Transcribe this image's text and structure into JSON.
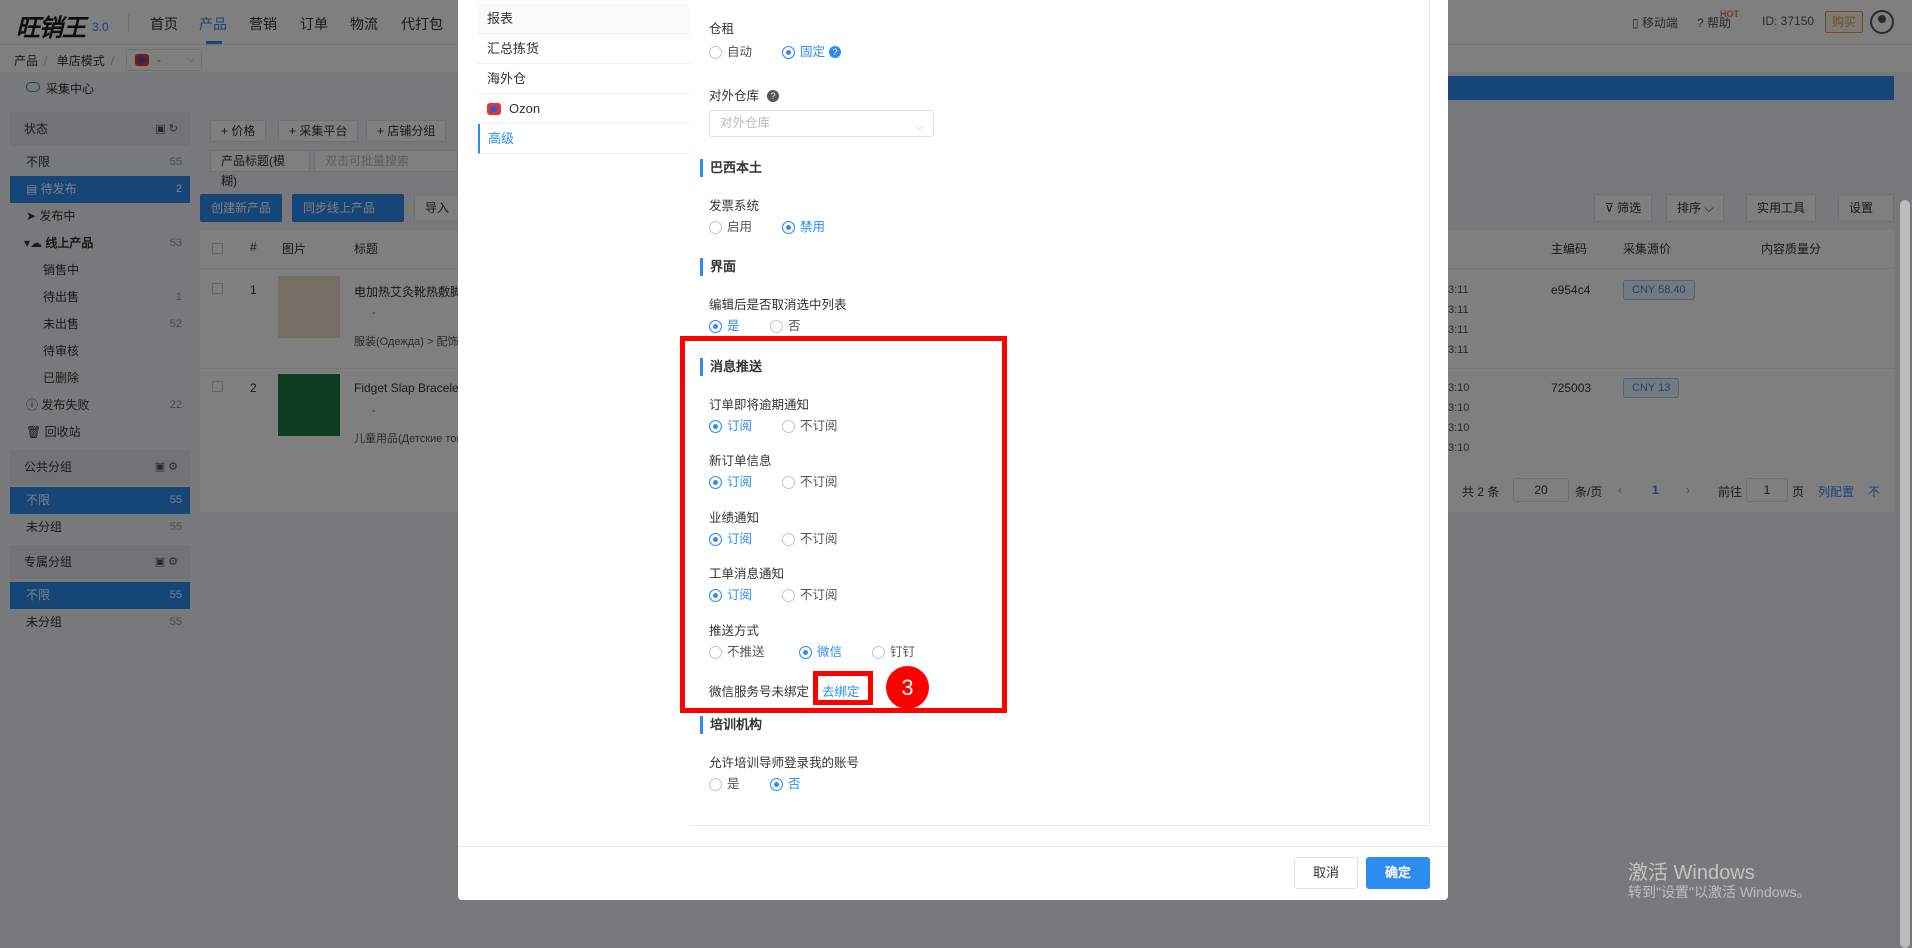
{
  "topnav": {
    "logo": "旺销王",
    "version": "3.0",
    "items": [
      "首页",
      "产品",
      "营销",
      "订单",
      "物流",
      "代打包"
    ],
    "mobile": "移动端",
    "hot": "HOT",
    "help": "帮助",
    "account_id": "ID: 37150",
    "buy": "购买"
  },
  "breadcrumb": {
    "items": [
      "产品",
      "单店模式"
    ],
    "store": "-"
  },
  "sidebar": {
    "collect": "采集中心",
    "status_header": "状态",
    "status": [
      {
        "label": "不限",
        "count": "55"
      },
      {
        "label": "待发布",
        "count": "2"
      },
      {
        "label": "发布中",
        "count": ""
      },
      {
        "label": "线上产品",
        "count": "53"
      },
      {
        "label": "销售中",
        "count": ""
      },
      {
        "label": "待出售",
        "count": "1"
      },
      {
        "label": "未出售",
        "count": "52"
      },
      {
        "label": "待审核",
        "count": ""
      },
      {
        "label": "已删除",
        "count": ""
      },
      {
        "label": "发布失败",
        "count": "22"
      },
      {
        "label": "回收站",
        "count": ""
      }
    ],
    "public_header": "公共分组",
    "public": [
      {
        "label": "不限",
        "count": "55"
      },
      {
        "label": "未分组",
        "count": "55"
      }
    ],
    "private_header": "专属分组",
    "private": [
      {
        "label": "不限",
        "count": "55"
      },
      {
        "label": "未分组",
        "count": "55"
      }
    ]
  },
  "toolbar": {
    "price": "+ 价格",
    "platform": "+ 采集平台",
    "store_group": "+ 店铺分组",
    "search_type": "产品标题(模糊)",
    "search_placeholder": "双击可批量搜索",
    "create": "创建新产品",
    "sync": "同步线上产品",
    "import": "导入",
    "filter": "筛选",
    "sort": "排序",
    "tools": "实用工具",
    "settings": "设置"
  },
  "table": {
    "headers": [
      "#",
      "图片",
      "标题",
      "主编码",
      "采集源价",
      "内容质量分"
    ],
    "rows": [
      {
        "idx": "1",
        "title": "电加热艾灸靴热敷脚",
        "category": "服装(Одежда) > 配饰",
        "code": "e954c4",
        "price": "CNY 58.40",
        "times": [
          "3:11",
          "3:11",
          "3:11",
          "3:11"
        ],
        "ozon": "-"
      },
      {
        "idx": "2",
        "title": "Fidget Slap Bracelet",
        "category": "儿童用品(Детские тов",
        "code": "725003",
        "price": "CNY 13",
        "times": [
          "3:10",
          "3:10",
          "3:10",
          "3:10"
        ],
        "ozon": "-"
      }
    ]
  },
  "pager": {
    "total": "共 2 条",
    "size": "20",
    "per_page": "条/页",
    "current": "1",
    "goto": "前往",
    "goto_val": "1",
    "page": "页",
    "config": "列配置",
    "top": "不"
  },
  "modal": {
    "nav": [
      "报表",
      "汇总拣货",
      "海外仓",
      "Ozon",
      "高级"
    ],
    "rent_label": "仓租",
    "rent_auto": "自动",
    "rent_fixed": "固定",
    "ext_wh_label": "对外仓库",
    "ext_wh_placeholder": "对外仓库",
    "brazil_section": "巴西本土",
    "invoice_label": "发票系统",
    "invoice_on": "启用",
    "invoice_off": "禁用",
    "ui_section": "界面",
    "deselect_label": "编辑后是否取消选中列表",
    "yes": "是",
    "no": "否",
    "msg_section": "消息推送",
    "order_overdue": "订单即将逾期通知",
    "new_order": "新订单信息",
    "perf": "业绩通知",
    "ticket": "工单消息通知",
    "subscribe": "订阅",
    "unsubscribe": "不订阅",
    "push_method": "推送方式",
    "push_none": "不推送",
    "push_wechat": "微信",
    "push_dingtalk": "钉钉",
    "wechat_unbound": "微信服务号未绑定",
    "go_bind": "去绑定",
    "training_section": "培训机构",
    "training_label": "允许培训导师登录我的账号",
    "cancel": "取消",
    "ok": "确定"
  },
  "annotation": {
    "step": "3"
  },
  "watermark": {
    "line1": "激活 Windows",
    "line2": "转到\"设置\"以激活 Windows。"
  }
}
